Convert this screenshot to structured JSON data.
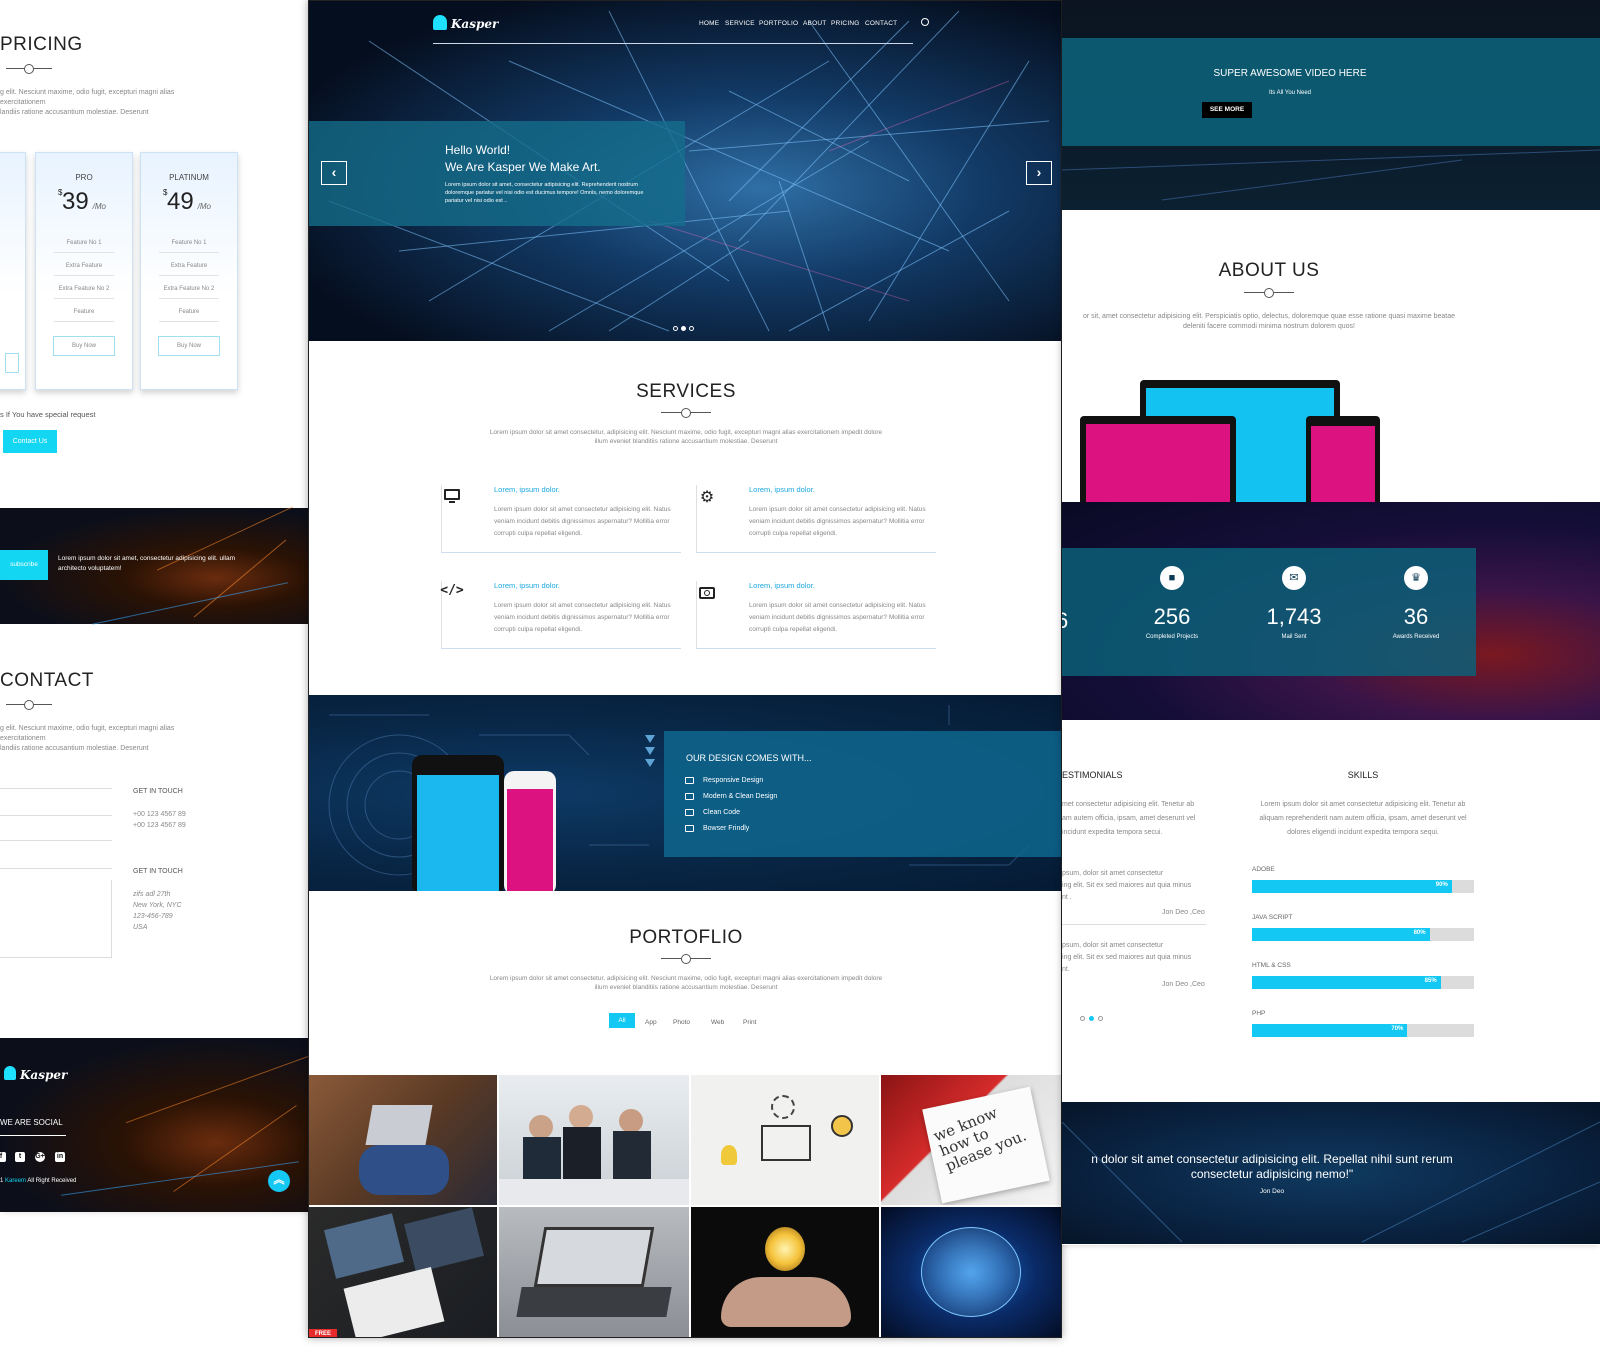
{
  "left": {
    "pricing": {
      "title": "PRICING",
      "description": "g elit. Nesciunt maxime, odio fugit, excepturi magni alias exercitationem\nlandiis ratione accusantium molestiae. Deserunt",
      "plans": [
        {
          "name": "PRO",
          "currency": "$",
          "price": "39",
          "period": "/Mo",
          "features": [
            "Feature No 1",
            "Extra Feature",
            "Extra Feature No 2",
            "Feature"
          ],
          "cta": "Buy Now"
        },
        {
          "name": "PLATINUM",
          "currency": "$",
          "price": "49",
          "period": "/Mo",
          "features": [
            "Feature No 1",
            "Extra Feature",
            "Extra Feature No 2",
            "Feature"
          ],
          "cta": "Buy Now"
        }
      ],
      "special_request": "s If You have special request",
      "contact_button": "Contact Us"
    },
    "subscribe": {
      "button": "subscribe",
      "text": "Lorem ipsum dolor sit amet, consectetur adipisicing elit. ullam architecto voluptatem!"
    },
    "contact": {
      "title": "CONTACT",
      "description": "g elit. Nesciunt maxime, odio fugit, excepturi magni alias exercitationem\nlandiis ratione accusantium molestiae. Deserunt",
      "get_in_touch_1": "GET IN TOUCH",
      "phones": [
        "+00 123 4567 89",
        "+00 123 4567 89"
      ],
      "get_in_touch_2": "GET IN TOUCH",
      "address": [
        "zifs adl 27th",
        "New York, NYC",
        "123-456-789",
        "USA"
      ]
    },
    "footer": {
      "logo": "Kasper",
      "social_title": "WE ARE SOCIAL",
      "social_icons": [
        "f",
        "t",
        "G+",
        "in"
      ],
      "copyright_name": "Kareem",
      "copyright_text": "All Right Received",
      "copyright_prefix": "1"
    }
  },
  "mid": {
    "logo": "Kasper",
    "nav": [
      "HOME",
      "SERVICE",
      "PORTFOLIO",
      "ABOUT",
      "PRICING",
      "CONTACT"
    ],
    "hero": {
      "line1": "Hello World!",
      "line2": "We Are Kasper We Make Art.",
      "text": "Lorem ipsum dolor sit amet, consectetur adipisicing elit. Reprehenderit nostrum doloremque pariatur vel nisi odio est ducimus tempore! Omnis, nemo doloremque pariatur vel nisi odio est ..",
      "prev": "‹",
      "next": "›"
    },
    "services": {
      "title": "SERVICES",
      "description": "Lorem ipsum dolor sit amet consectetur, adipisicing elit. Nesciunt maxime, odio fugit, excepturi magni alias exercitationem impedit dolore\nillum eveniet blanditiis ratione accusantium molestiae. Deserunt",
      "items": [
        {
          "icon": "monitor-icon",
          "title": "Lorem, ipsum dolor.",
          "text": "Lorem ipsum dolor sit amet consectetur adipisicing elit. Natus veniam incidunt debitis dignissimos aspernatur? Mollitia error corrupti culpa repellat eligendi."
        },
        {
          "icon": "gear-icon",
          "title": "Lorem, ipsum dolor.",
          "text": "Lorem ipsum dolor sit amet consectetur adipisicing elit. Natus veniam incidunt debitis dignissimos aspernatur? Mollitia error corrupti culpa repellat eligendi."
        },
        {
          "icon": "code-icon",
          "title": "Lorem, ipsum dolor.",
          "text": "Lorem ipsum dolor sit amet consectetur adipisicing elit. Natus veniam incidunt debitis dignissimos aspernatur? Mollitia error corrupti culpa repellat eligendi."
        },
        {
          "icon": "camera-icon",
          "title": "Lorem, ipsum dolor.",
          "text": "Lorem ipsum dolor sit amet consectetur adipisicing elit. Natus veniam incidunt debitis dignissimos aspernatur? Mollitia error corrupti culpa repellat eligendi."
        }
      ]
    },
    "design": {
      "title": "OUR DESIGN COMES WITH...",
      "items": [
        "Responsive Design",
        "Modern & Clean Design",
        "Clean Code",
        "Bowser Frindly"
      ]
    },
    "portfolio": {
      "title": "PORTOFLIO",
      "description": "Lorem ipsum dolor sit amet consectetur, adipisicing elit. Nesciunt maxime, odio fugit, excepturi magni alias exercitationem impedit dolore\nillum eveniet blanditiis ratione accusantium molestiae. Deserunt",
      "filters": [
        "All",
        "App",
        "Photo",
        "Web",
        "Print"
      ],
      "active_filter": "All",
      "thumb_overlay_text": "we know how to please you.",
      "free_badge": "FREE"
    }
  },
  "right": {
    "video": {
      "title": "SUPER AWESOME VIDEO HERE",
      "subtitle": "Its All You Need",
      "button": "SEE MORE"
    },
    "about": {
      "title": "ABOUT US",
      "description": "or sit, amet consectetur adipisicing elit. Perspiciatis optio, delectus, doloremque quae esse ratione quasi maxime beatae\ndeleniti facere commodi minima nostrum dolorem quos!"
    },
    "stats": {
      "partial_number": "6",
      "items": [
        {
          "icon": "folder-icon",
          "number": "256",
          "label": "Completed Projects"
        },
        {
          "icon": "envelope-icon",
          "number": "1,743",
          "label": "Mail Sent"
        },
        {
          "icon": "trophy-icon",
          "number": "36",
          "label": "Awards Received"
        }
      ]
    },
    "testimonials": {
      "title": "ESTIMONIALS",
      "text": "met consectetur adipisicing elit. Tenetur ab\nam autem officia, ipsam, amet deserunt vel\n incidunt expedita tempora secui.",
      "quote1": "psum, dolor sit amet consectetur\ning elit. Sit ex sed maiores aut quia minus\nnt .",
      "author1": "Jon Deo ,Ceo",
      "quote2": "psum, dolor sit amet consectetur\ning elit. Sit ex sed maiores aut quia minus\nnt.",
      "author2": "Jon Deo ,Ceo"
    },
    "skills": {
      "title": "SKILLS",
      "text": "Lorem ipsum dolor sit amet consectetur adipisicing elit. Tenetur ab\naliquam reprehenderit nam autem officia, ipsam, amet deserunt vel\ndolores eligendi incidunt expedita tempora sequi.",
      "items": [
        {
          "name": "ADOBE",
          "percent": 90,
          "label": "90%"
        },
        {
          "name": "JAVA SCRIPT",
          "percent": 80,
          "label": "80%"
        },
        {
          "name": "HTML & CSS",
          "percent": 85,
          "label": "85%"
        },
        {
          "name": "PHP",
          "percent": 70,
          "label": "70%"
        }
      ]
    },
    "quote": {
      "line1": "n dolor sit amet consectetur adipisicing elit. Repellat nihil sunt rerum",
      "line2": "consectetur adipisicing nemo!\"",
      "author": "Jon Deo"
    }
  }
}
